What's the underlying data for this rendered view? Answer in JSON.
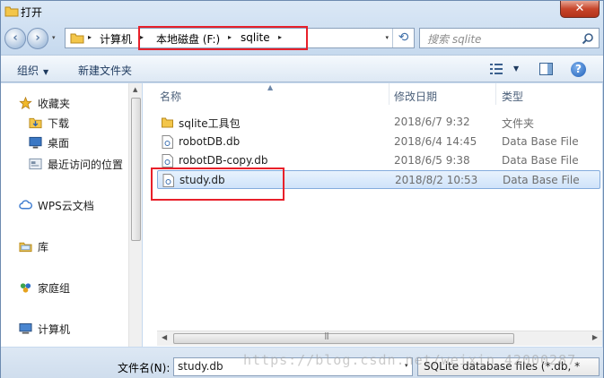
{
  "window": {
    "title": "打开",
    "close_symbol": "✕"
  },
  "nav": {
    "back": "‹",
    "forward": "›",
    "dropdown": "▾"
  },
  "address": {
    "parts": [
      "计算机",
      "本地磁盘 (F:)",
      "sqlite"
    ],
    "separator": "▸",
    "dropdown": "▾",
    "refresh": "⟲"
  },
  "search": {
    "placeholder": "搜索 sqlite"
  },
  "toolbar": {
    "organize": "组织",
    "new_folder": "新建文件夹",
    "caret": "▼",
    "help": "?"
  },
  "sidebar": {
    "items": [
      {
        "label": "收藏夹",
        "icon": "star-icon"
      },
      {
        "label": "下载",
        "icon": "download-folder-icon"
      },
      {
        "label": "桌面",
        "icon": "desktop-icon"
      },
      {
        "label": "最近访问的位置",
        "icon": "recent-places-icon"
      },
      {
        "label": "WPS云文档",
        "icon": "cloud-icon"
      },
      {
        "label": "库",
        "icon": "library-icon"
      },
      {
        "label": "家庭组",
        "icon": "homegroup-icon"
      },
      {
        "label": "计算机",
        "icon": "computer-icon"
      }
    ]
  },
  "columns": {
    "name": "名称",
    "date": "修改日期",
    "type": "类型"
  },
  "files": [
    {
      "name": "sqlite工具包",
      "date": "2018/6/7 9:32",
      "type": "文件夹",
      "kind": "folder"
    },
    {
      "name": "robotDB.db",
      "date": "2018/6/4 14:45",
      "type": "Data Base File",
      "kind": "db"
    },
    {
      "name": "robotDB-copy.db",
      "date": "2018/6/5 9:38",
      "type": "Data Base File",
      "kind": "db"
    },
    {
      "name": "study.db",
      "date": "2018/8/2 10:53",
      "type": "Data Base File",
      "kind": "db",
      "selected": true
    }
  ],
  "bottom": {
    "filename_label": "文件名(N):",
    "filename_value": "study.db",
    "filter": "SQLite database files (*.db, *"
  },
  "watermark": "https://blog.csdn.net/weixin_42000287",
  "colors": {
    "highlight": "#e8202a",
    "selection": "#cfe3fa",
    "toolbar_text": "#1e3a5f"
  }
}
